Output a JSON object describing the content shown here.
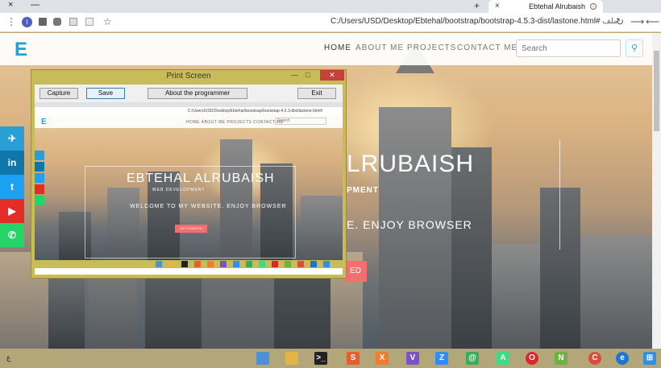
{
  "browser": {
    "tab_title": "Ebtehal Alrubaish",
    "tab_close": "×",
    "new_tab": "+",
    "win_min": "—",
    "win_close": "×",
    "url_main": "C:/Users/USD/Desktop/Ebtehal/bootstrap/bootstrap-4.5.3-dist/lastone.html#",
    "url_prefix": "ملف",
    "profile_initial": "I",
    "back_icon": "⟵",
    "forward_icon": "⟶",
    "reload_icon": "↻",
    "star_icon": "☆",
    "menu_icon": "⋮"
  },
  "site": {
    "logo": "E",
    "nav": {
      "home": "HOME",
      "about": "ABOUT ME",
      "projects": "PROJECTS",
      "contact": "CONTACT ME"
    },
    "search_placeholder": "Search",
    "search_icon": "magnifier-icon",
    "hero_title": "LRUBAISH",
    "hero_sub": "PMENT",
    "hero_welcome": "E. ENJOY BROWSER",
    "hero_button": "ED",
    "social": [
      {
        "name": "telegram",
        "glyph": "✈",
        "color": "#2a9fd6"
      },
      {
        "name": "linkedin",
        "glyph": "in",
        "color": "#0e76a8"
      },
      {
        "name": "twitter",
        "glyph": "t",
        "color": "#1da1f2"
      },
      {
        "name": "youtube",
        "glyph": "▶",
        "color": "#e52d27"
      },
      {
        "name": "whatsapp",
        "glyph": "✆",
        "color": "#25d366"
      }
    ]
  },
  "printscreen": {
    "title": "Print Screen",
    "min": "—",
    "max": "□",
    "close": "✕",
    "buttons": {
      "capture": "Capture",
      "save": "Save",
      "about": "About the programmer",
      "exit": "Exit"
    },
    "mini": {
      "url": "C:/Users/USD/Desktop/Ebtehal/bootstrap/bootstrap-4.5.3-dist/lastone.html#",
      "tab_title": "Ebtehal Alrubaish",
      "logo": "E",
      "menu": "HOME   ABOUT ME   PROJECTS   CONTACT ME",
      "search": "Search",
      "title": "EBTEHAL ALRUBAISH",
      "sub": "WEB DEVELOPMENT",
      "welcome": "WELCOME TO MY WEBSITE. ENJOY BROWSER",
      "button": "GET STARTED"
    }
  },
  "taskbar": {
    "lang": "ع",
    "apps": [
      {
        "name": "file-explorer-window",
        "color": "#4e90d6",
        "glyph": ""
      },
      {
        "name": "file-explorer",
        "color": "#e3b544",
        "glyph": ""
      },
      {
        "name": "terminal",
        "color": "#222222",
        "glyph": ">_"
      },
      {
        "name": "sublime",
        "color": "#e85d2c",
        "glyph": "S"
      },
      {
        "name": "xampp",
        "color": "#f27b2e",
        "glyph": "X"
      },
      {
        "name": "visual-studio",
        "color": "#7b52c6",
        "glyph": "V"
      },
      {
        "name": "zoom",
        "color": "#2d8cff",
        "glyph": "Z"
      },
      {
        "name": "globe-app",
        "color": "#3bad5a",
        "glyph": "@"
      },
      {
        "name": "android-studio",
        "color": "#3ddc84",
        "glyph": "A"
      },
      {
        "name": "opera",
        "color": "#e0242c",
        "glyph": "O"
      },
      {
        "name": "notepad",
        "color": "#6eb245",
        "glyph": "N"
      },
      {
        "name": "chrome",
        "color": "#dd4b39",
        "glyph": "C"
      },
      {
        "name": "edge",
        "color": "#1c75d1",
        "glyph": "e"
      },
      {
        "name": "windows",
        "color": "#2f8fe0",
        "glyph": "⊞"
      }
    ]
  }
}
